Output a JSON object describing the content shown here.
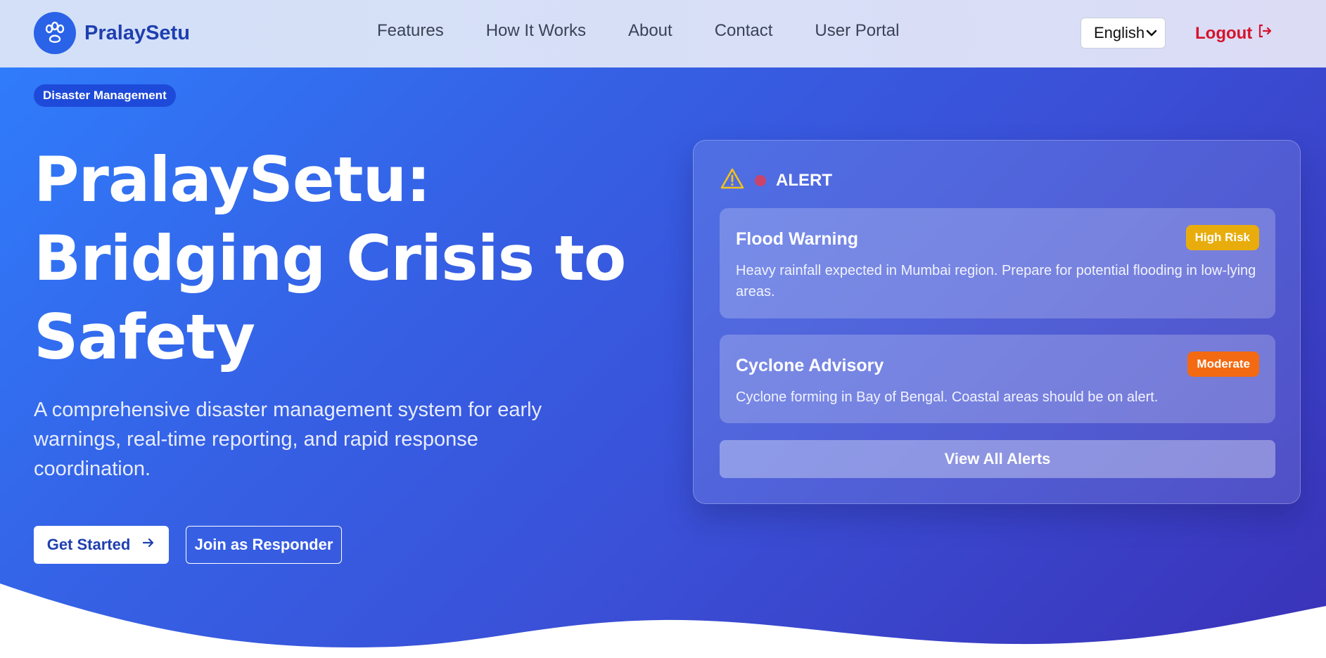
{
  "brand": {
    "name": "PralaySetu"
  },
  "nav": {
    "items": [
      {
        "label": "Features"
      },
      {
        "label": "How It Works"
      },
      {
        "label": "About"
      },
      {
        "label": "Contact"
      },
      {
        "label": "User Portal"
      }
    ]
  },
  "header": {
    "language": "English",
    "logout_label": "Logout"
  },
  "hero": {
    "tag": "Disaster Management",
    "title_line1": "PralaySetu:",
    "title_line2": "Bridging Crisis to",
    "title_line3": "Safety",
    "subtitle": "A comprehensive disaster management system for early warnings, real-time reporting, and rapid response coordination.",
    "primary_button": "Get Started",
    "secondary_button": "Join as Responder"
  },
  "alerts": {
    "heading": "ALERT",
    "items": [
      {
        "title": "Flood Warning",
        "badge": "High Risk",
        "text": "Heavy rainfall expected in Mumbai region. Prepare for potential flooding in low-lying areas."
      },
      {
        "title": "Cyclone Advisory",
        "badge": "Moderate",
        "text": "Cyclone forming in Bay of Bengal. Coastal areas should be on alert."
      }
    ],
    "view_all_label": "View All Alerts"
  },
  "colors": {
    "brand": "#2a62e8",
    "logout": "#d6122a",
    "high_risk": "#e8ad0d",
    "moderate": "#f36a12"
  }
}
